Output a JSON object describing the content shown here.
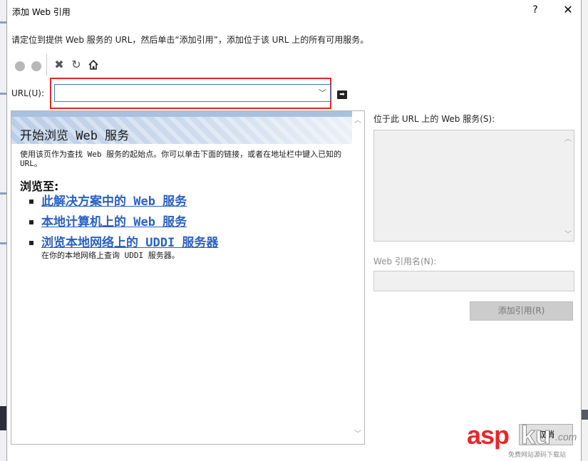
{
  "window": {
    "title": "添加 Web 引用",
    "help_label": "?",
    "close_label": "✕"
  },
  "instruction": "请定位到提供 Web 服务的 URL，然后单击“添加引用”，添加位于该 URL 上的所有可用服务。",
  "toolbar": {
    "icons": [
      "back-icon",
      "forward-icon",
      "stop-icon",
      "refresh-icon",
      "home-icon"
    ]
  },
  "url": {
    "label": "URL(U):",
    "value": "",
    "highlight_color": "#e0262a"
  },
  "browser": {
    "header_title": "开始浏览 Web 服务",
    "description": "使用该页作为查找 Web 服务的起始点。你可以单击下面的链接，或者在地址栏中键入已知的 URL。",
    "browse_to": "浏览至:",
    "links": [
      {
        "label": "此解决方案中的 Web 服务"
      },
      {
        "label": "本地计算机上的 Web 服务"
      },
      {
        "label": "浏览本地网络上的 UDDI 服务器"
      }
    ],
    "uddi_note": "在你的本地网络上查询 UDDI 服务器。",
    "link_color": "#2a62c0"
  },
  "right_panel": {
    "services_label": "位于此 URL 上的 Web 服务(S):",
    "refname_label": "Web 引用名(N):",
    "refname_value": "",
    "add_ref_button": "添加引用(R)",
    "bottom_button": "取消"
  },
  "watermark": {
    "asp": "asp",
    "ku": "ku",
    "com": ".com",
    "sub": "免费网站源码下载站"
  }
}
